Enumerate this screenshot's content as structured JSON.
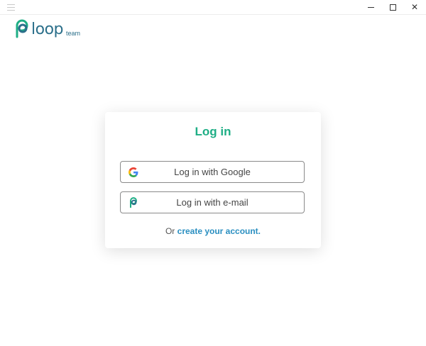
{
  "window": {
    "menu_icon": "hamburger-icon",
    "minimize_icon": "minimize-icon",
    "maximize_icon": "maximize-icon",
    "close_glyph": "✕"
  },
  "logo": {
    "word": "loop",
    "sub": "team",
    "color": "#2b6f8a"
  },
  "login": {
    "title": "Log in",
    "title_color": "#1eae85",
    "google_button_label": "Log in with Google",
    "email_button_label": "Log in with e-mail",
    "footer_prefix": "Or ",
    "footer_link": "create your account."
  },
  "colors": {
    "accent": "#1eae85",
    "link": "#2a8fc1"
  }
}
